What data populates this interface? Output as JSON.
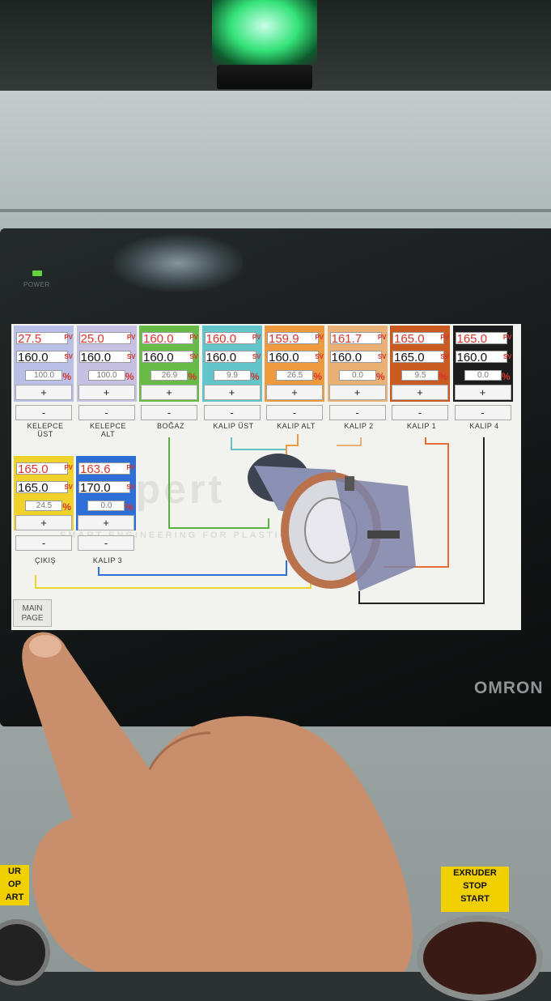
{
  "device": {
    "power_label": "POWER",
    "brand": "OMRON"
  },
  "screen": {
    "zones": [
      {
        "pv": "27.5",
        "sv": "160.0",
        "out": "100.0",
        "label": "KELEPCE\nÜST",
        "color": "#b9bfe6"
      },
      {
        "pv": "25.0",
        "sv": "160.0",
        "out": "100.0",
        "label": "KELEPCE\nALT",
        "color": "#c6c1e2"
      },
      {
        "pv": "160.0",
        "sv": "160.0",
        "out": "26.9",
        "label": "BOĞAZ",
        "color": "#67bb46"
      },
      {
        "pv": "160.0",
        "sv": "160.0",
        "out": "9.9",
        "label": "KALIP ÜST",
        "color": "#63c5c9"
      },
      {
        "pv": "159.9",
        "sv": "160.0",
        "out": "26.5",
        "label": "KALIP ALT",
        "color": "#ef9a3e"
      },
      {
        "pv": "161.7",
        "sv": "160.0",
        "out": "0.0",
        "label": "KALIP 2",
        "color": "#e9b173"
      },
      {
        "pv": "165.0",
        "sv": "165.0",
        "out": "9.5",
        "label": "KALIP 1",
        "color": "#c95a22"
      },
      {
        "pv": "165.0",
        "sv": "160.0",
        "out": "0.0",
        "label": "KALIP 4",
        "color": "#1d1d1d"
      }
    ],
    "zones_lower": [
      {
        "pv": "165.0",
        "sv": "165.0",
        "out": "24.5",
        "label": "ÇIKIŞ",
        "color": "#f1d22a"
      },
      {
        "pv": "163.6",
        "sv": "170.0",
        "out": "0.0",
        "label": "KALIP 3",
        "color": "#2d6fd6"
      }
    ],
    "tags": {
      "pv": "PV",
      "sv": "SV",
      "pct": "%"
    },
    "buttons": {
      "plus": "+",
      "minus": "-"
    },
    "main_page": "MAIN PAGE",
    "watermark": "SMART ENGINEERING FOR PLASTIC EXTRUSION",
    "watermark_logo": "expert"
  },
  "panel_plates": {
    "left": "UR\nOP\nART",
    "right": "EXRUDER\nSTOP\nSTART"
  }
}
